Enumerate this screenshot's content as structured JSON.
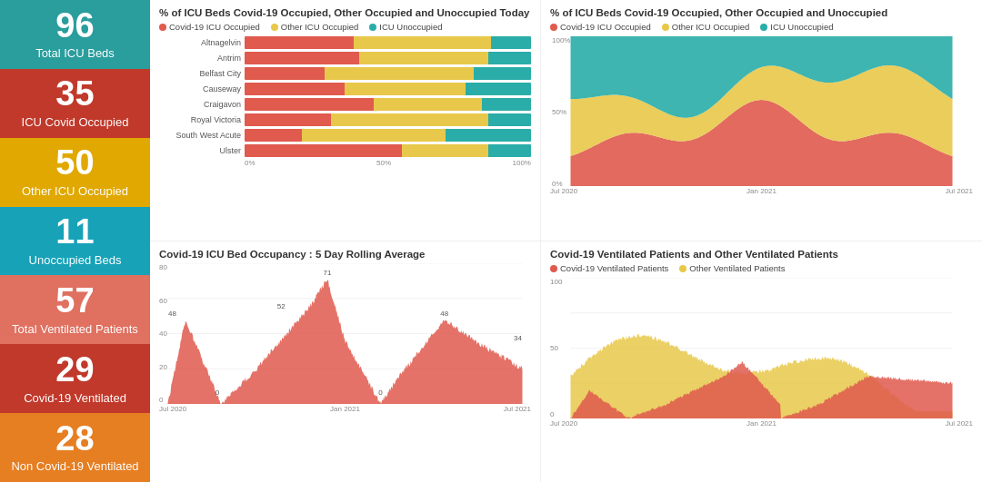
{
  "sidebar": {
    "cards": [
      {
        "id": "total-icu",
        "number": "96",
        "label": "Total ICU Beds",
        "colorClass": "card-teal"
      },
      {
        "id": "icu-covid",
        "number": "35",
        "label": "ICU Covid Occupied",
        "colorClass": "card-red"
      },
      {
        "id": "other-icu",
        "number": "50",
        "label": "Other ICU Occupied",
        "colorClass": "card-yellow"
      },
      {
        "id": "unoccupied",
        "number": "11",
        "label": "Unoccupied Beds",
        "colorClass": "card-cyan"
      },
      {
        "id": "total-vent",
        "number": "57",
        "label": "Total Ventilated Patients",
        "colorClass": "card-salmon"
      },
      {
        "id": "covid-vent",
        "number": "29",
        "label": "Covid-19 Ventilated",
        "colorClass": "card-red2"
      },
      {
        "id": "non-covid-vent",
        "number": "28",
        "label": "Non Covid-19 Ventilated",
        "colorClass": "card-orange"
      }
    ]
  },
  "topLeft": {
    "title": "% of ICU Beds Covid-19 Occupied, Other Occupied and Unoccupied Today",
    "legend": [
      {
        "label": "Covid-19 ICU Occupied",
        "color": "#e05a4e"
      },
      {
        "label": "Other ICU Occupied",
        "color": "#e8c84a"
      },
      {
        "label": "ICU Unoccupied",
        "color": "#2aada8"
      }
    ],
    "hospitals": [
      {
        "name": "Altnagelvin",
        "covid": 38,
        "other": 48,
        "unoccupied": 14
      },
      {
        "name": "Antrim",
        "covid": 40,
        "other": 45,
        "unoccupied": 15
      },
      {
        "name": "Belfast City",
        "covid": 28,
        "other": 52,
        "unoccupied": 20
      },
      {
        "name": "Causeway",
        "covid": 35,
        "other": 42,
        "unoccupied": 23
      },
      {
        "name": "Craigavon",
        "covid": 45,
        "other": 38,
        "unoccupied": 17
      },
      {
        "name": "Royal Victoria",
        "covid": 30,
        "other": 55,
        "unoccupied": 15
      },
      {
        "name": "South West Acute",
        "covid": 20,
        "other": 50,
        "unoccupied": 30
      },
      {
        "name": "Ulster",
        "covid": 55,
        "other": 30,
        "unoccupied": 15
      }
    ],
    "axisLabels": [
      "0%",
      "50%",
      "100%"
    ]
  },
  "topRight": {
    "title": "% of ICU Beds Covid-19 Occupied, Other Occupied and Unoccupied",
    "legend": [
      {
        "label": "Covid-19 ICU Occupied",
        "color": "#e05a4e"
      },
      {
        "label": "Other ICU Occupied",
        "color": "#e8c84a"
      },
      {
        "label": "ICU Unoccupied",
        "color": "#2aada8"
      }
    ],
    "axisLabels": {
      "x": [
        "Jul 2020",
        "Jan 2021",
        "Jul 2021"
      ],
      "y": [
        "0%",
        "50%",
        "100%"
      ]
    }
  },
  "bottomLeft": {
    "title": "Covid-19 ICU Bed Occupancy : 5 Day Rolling Average",
    "legend": [],
    "annotations": [
      "48",
      "0",
      "52",
      "71",
      "0",
      "48",
      "34"
    ],
    "axisLabels": {
      "x": [
        "Jul 2020",
        "Jan 2021",
        "Jul 2021"
      ],
      "y": [
        "0",
        "20",
        "40",
        "60",
        "80"
      ]
    }
  },
  "bottomRight": {
    "title": "Covid-19 Ventilated Patients and Other Ventilated Patients",
    "legend": [
      {
        "label": "Covid-19 Ventilated Patients",
        "color": "#e05a4e"
      },
      {
        "label": "Other Ventilated Patients",
        "color": "#e8c84a"
      }
    ],
    "axisLabels": {
      "x": [
        "Jul 2020",
        "Jan 2021",
        "Jul 2021"
      ],
      "y": [
        "0",
        "50",
        "100"
      ]
    }
  }
}
